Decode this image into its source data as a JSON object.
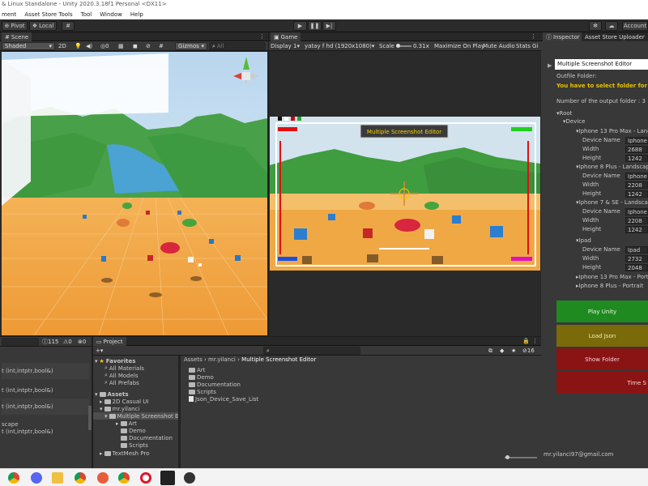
{
  "window": {
    "title": "& Linux Standalone - Unity 2020.3.18f1 Personal <DX11>"
  },
  "menu": [
    "ment",
    "Asset Store Tools",
    "Tool",
    "Window",
    "Help"
  ],
  "toolbar": {
    "pivot": "Pivot",
    "local": "Local",
    "account": "Account"
  },
  "scene": {
    "tab": "Scene",
    "shading": "Shaded",
    "mode": "2D",
    "fx_count": "0",
    "gizmos": "Gizmos",
    "search_placeholder": "All"
  },
  "game": {
    "tab": "Game",
    "display": "Display 1",
    "resolution": "yatay f hd (1920x1080)",
    "scale_label": "Scale",
    "scale_value": "0.31x",
    "maximize": "Maximize On Play",
    "mute": "Mute Audio",
    "stats": "Stats",
    "gizmos": "Gi",
    "overlay_banner": "Multiple Screenshot Editor"
  },
  "inspector": {
    "tab_inspector": "Inspector",
    "tab_uploader": "Asset Store Uploader",
    "editor_name": "Multiple Screenshot Editor",
    "outfile_label": "Outfile Folder:",
    "warning": "You have to select folder for save t",
    "output_count": "Number of the output folder : 3",
    "root": "Root",
    "device": "Device",
    "devices": [
      {
        "header": "Iphone 13 Pro Max - Landsc",
        "name_value": "Iphone 1",
        "width": "2688",
        "height": "1242"
      },
      {
        "header": "Iphone 8 Plus - Landscape",
        "name_value": "Iphone 8",
        "width": "2208",
        "height": "1242"
      },
      {
        "header": "Iphone 7 & SE - Landscape",
        "name_value": "Iphone 7",
        "width": "2208",
        "height": "1242"
      },
      {
        "header": "Ipad",
        "name_value": "Ipad",
        "width": "2732",
        "height": "2048"
      }
    ],
    "collapsed": [
      "Iphone 13 Pro Max - Portra",
      "Iphone 8 Plus - Portrait"
    ],
    "field_labels": {
      "name": "Device Name",
      "width": "Width",
      "height": "Height"
    },
    "buttons": {
      "play": "Play Unity",
      "load": "Load Json",
      "show": "Show Folder",
      "time": "Time S"
    },
    "email": "mr.yilanci97@gmail.com"
  },
  "console": {
    "counts": {
      "warnings": "115",
      "errors": "0",
      "logs": "0"
    },
    "lines": [
      "t (int,intptr,bool&)",
      "t (int,intptr,bool&)",
      "t (int,intptr,bool&)",
      "scape",
      "t (int,intptr,bool&)"
    ]
  },
  "project": {
    "tab": "Project",
    "favorites": "Favorites",
    "favorite_items": [
      "All Materials",
      "All Models",
      "All Prefabs"
    ],
    "assets_label": "Assets",
    "tree": [
      "2D Casual UI",
      "mr.yilanci",
      "Multiple Screenshot E",
      "Art",
      "Demo",
      "Documentation",
      "Scripts",
      "TextMesh Pro"
    ],
    "breadcrumb": [
      "Assets",
      "mr.yilanci",
      "Multiple Screenshot Editor"
    ],
    "files": [
      "Art",
      "Demo",
      "Documentation",
      "Scripts",
      "Json_Device_Save_List"
    ],
    "hidden_count": "16"
  },
  "colors": {
    "play_btn": "#1f8a1f",
    "load_btn": "#7a6a0a",
    "show_btn": "#8a1414",
    "time_btn": "#8a1414",
    "warning_text": "#e8c200"
  },
  "taskbar_icons": [
    "chrome-icon",
    "discord-icon",
    "files-icon",
    "chrome-icon",
    "paint-icon",
    "chrome-icon",
    "opera-icon",
    "unity-hub-icon",
    "unity-icon"
  ]
}
